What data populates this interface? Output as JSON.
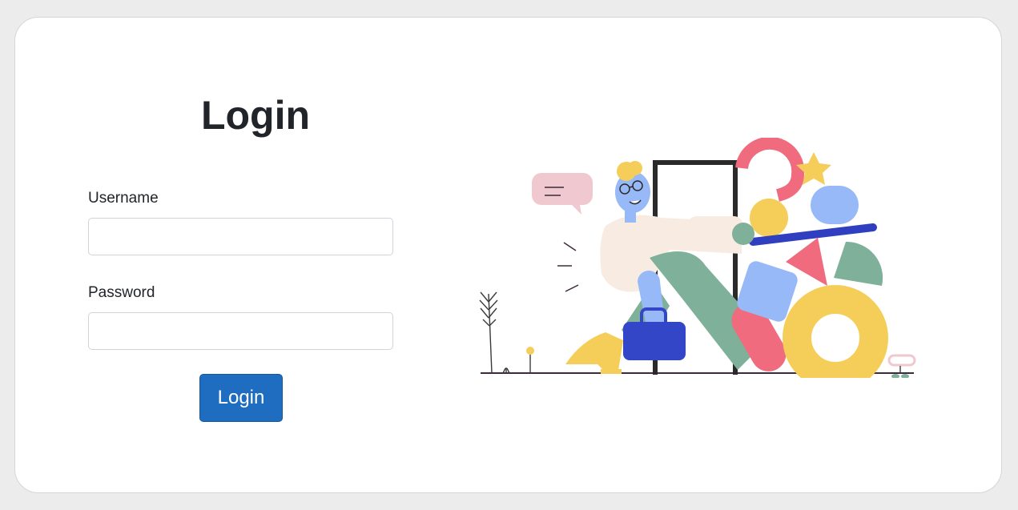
{
  "login": {
    "title": "Login",
    "username_label": "Username",
    "username_value": "",
    "password_label": "Password",
    "password_value": "",
    "submit_label": "Login"
  },
  "colors": {
    "background": "#ececec",
    "card": "#ffffff",
    "button": "#1f6dc0",
    "text": "#212529"
  },
  "illustration": {
    "icon": "person-walking-through-door-illustration"
  }
}
